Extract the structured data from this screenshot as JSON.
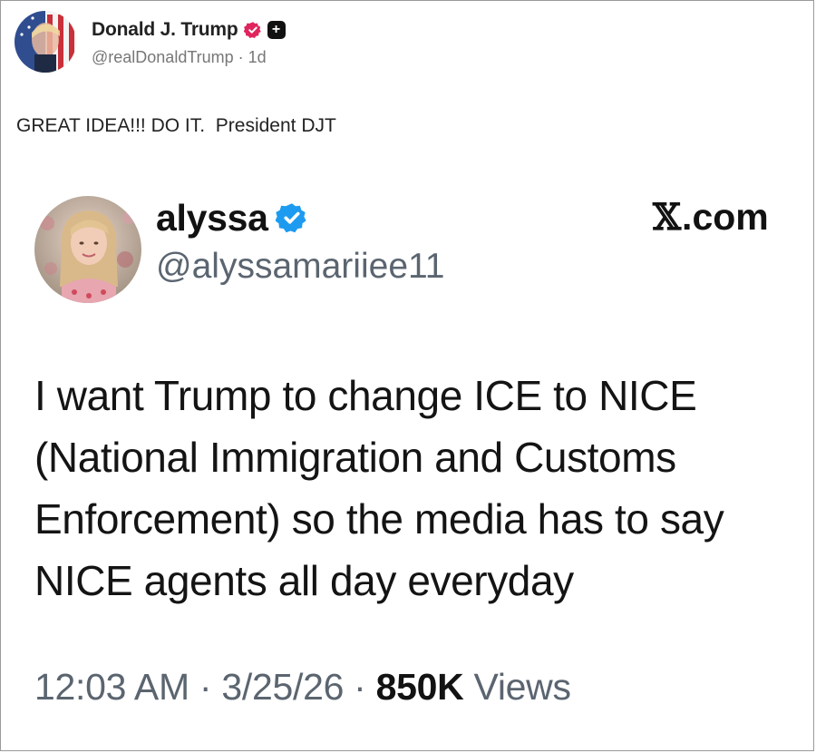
{
  "post": {
    "author_name": "Donald J. Trump",
    "handle": "@realDonaldTrump",
    "separator": " · ",
    "age": "1d",
    "text": "GREAT IDEA!!! DO IT.  President DJT",
    "verified_icon": "verified-badge-red",
    "extra_icon": "plus-square-icon",
    "plus_glyph": "+"
  },
  "embedded_tweet": {
    "author_name": "alyssa",
    "handle": "@alyssamariiee11",
    "verified_icon": "verified-badge-blue",
    "brand": {
      "logo_glyph": "𝕏",
      "suffix": ".com"
    },
    "body_lines": [
      "I want Trump to change ICE to NICE",
      "(National Immigration and Customs",
      "Enforcement) so the media has to say",
      "NICE agents all day everyday"
    ],
    "footer": {
      "time": "12:03 AM",
      "sep1": " · ",
      "date": "3/25/26",
      "sep2": " · ",
      "views_count": "850K",
      "views_label": " Views"
    }
  },
  "colors": {
    "verified_red": "#e0245e",
    "verified_blue": "#1d9bf0",
    "muted_text": "#5b6570"
  }
}
